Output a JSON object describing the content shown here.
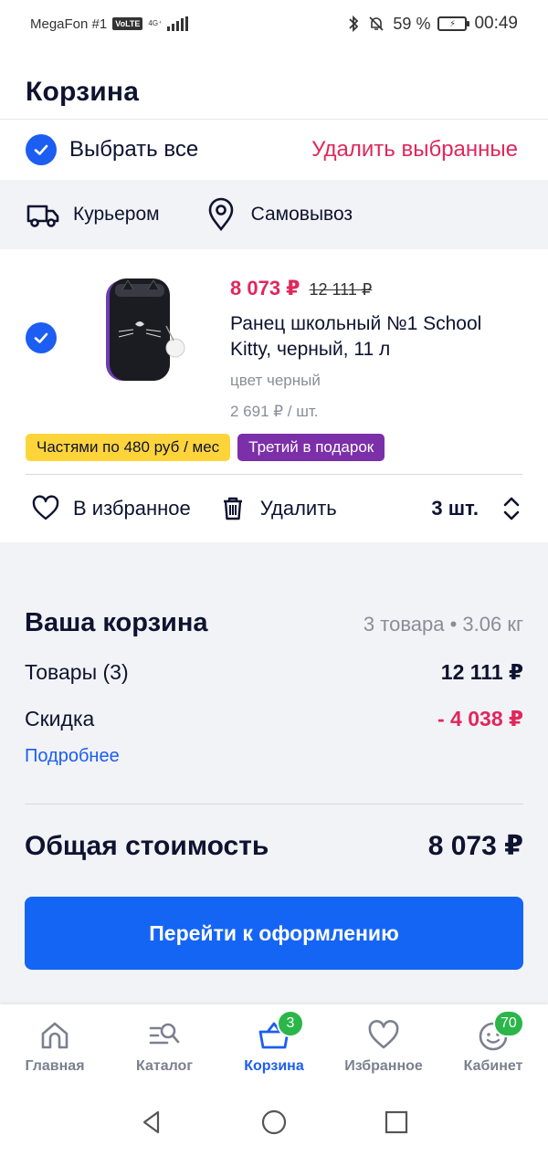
{
  "status": {
    "carrier": "MegaFon #1",
    "volte": "VoLTE",
    "network": "4G⁺",
    "battery": "59 %",
    "time": "00:49"
  },
  "header": {
    "title": "Корзина"
  },
  "select_row": {
    "select_all": "Выбрать все",
    "delete_selected": "Удалить выбранные"
  },
  "delivery": {
    "courier": "Курьером",
    "pickup": "Самовывоз"
  },
  "product": {
    "price_new": "8 073 ₽",
    "price_old": "12 111 ₽",
    "name": "Ранец школьный №1 School Kitty, черный, 11 л",
    "color": "цвет черный",
    "unit_price": "2 691 ₽ / шт.",
    "tag_installment": "Частями по 480 руб / мес",
    "tag_gift": "Третий в подарок",
    "favorite": "В избранное",
    "delete": "Удалить",
    "quantity": "3 шт."
  },
  "summary": {
    "title": "Ваша корзина",
    "meta": "3 товара • 3.06 кг",
    "goods_label": "Товары (3)",
    "goods_value": "12 111 ₽",
    "discount_label": "Скидка",
    "discount_value": "- 4 038 ₽",
    "more": "Подробнее",
    "total_label": "Общая стоимость",
    "total_value": "8 073 ₽",
    "checkout": "Перейти к оформлению"
  },
  "nav": {
    "home": "Главная",
    "catalog": "Каталог",
    "cart": "Корзина",
    "cart_badge": "3",
    "favorites": "Избранное",
    "cabinet": "Кабинет",
    "cabinet_badge": "70"
  },
  "colors": {
    "accent": "#1c5df2",
    "sale": "#e0275b",
    "badge": "#2bb64a"
  }
}
